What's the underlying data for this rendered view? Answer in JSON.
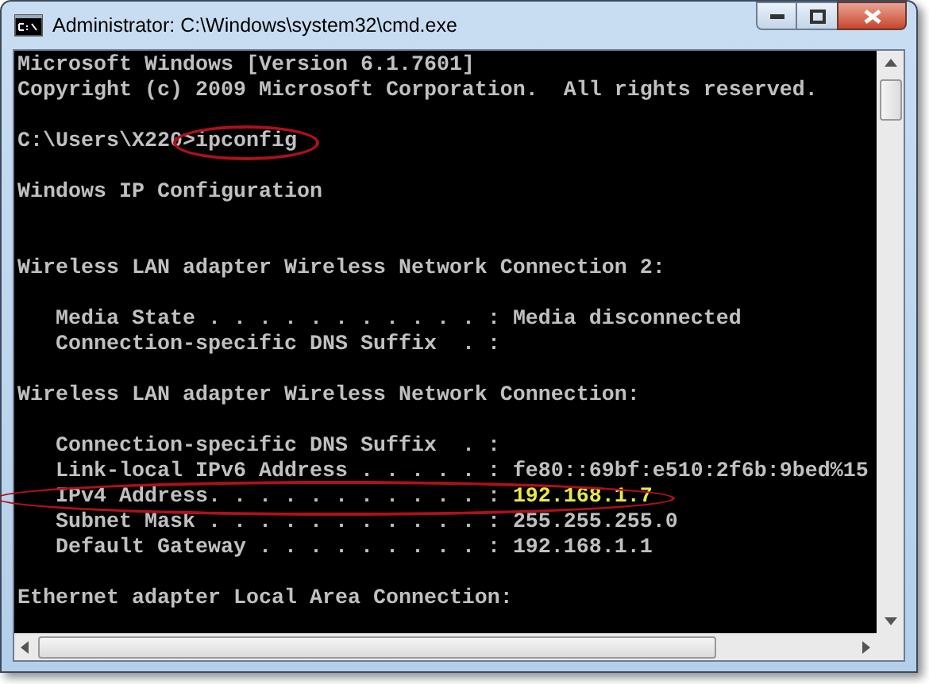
{
  "window": {
    "title": "Administrator: C:\\Windows\\system32\\cmd.exe"
  },
  "lines": [
    {
      "kind": "output",
      "text": "Microsoft Windows [Version 6.1.7601]"
    },
    {
      "kind": "output",
      "text": "Copyright (c) 2009 Microsoft Corporation.  All rights reserved."
    },
    {
      "kind": "blank"
    },
    {
      "kind": "prompt",
      "prompt": "C:\\Users\\X220>",
      "command": "ipconfig",
      "circled": true
    },
    {
      "kind": "blank"
    },
    {
      "kind": "output",
      "text": "Windows IP Configuration"
    },
    {
      "kind": "blank"
    },
    {
      "kind": "blank"
    },
    {
      "kind": "output",
      "text": "Wireless LAN adapter Wireless Network Connection 2:"
    },
    {
      "kind": "blank"
    },
    {
      "kind": "field",
      "label": "Media State . . . . . . . . . . . :",
      "value": "Media disconnected",
      "highlighted": false,
      "circled": false
    },
    {
      "kind": "field",
      "label": "Connection-specific DNS Suffix  . :",
      "circled": false
    },
    {
      "kind": "blank"
    },
    {
      "kind": "output",
      "text": "Wireless LAN adapter Wireless Network Connection:"
    },
    {
      "kind": "blank"
    },
    {
      "kind": "field",
      "label": "Connection-specific DNS Suffix  . :",
      "circled": false
    },
    {
      "kind": "field",
      "label": "Link-local IPv6 Address . . . . . :",
      "value": "fe80::69bf:e510:2f6b:9bed%15",
      "highlighted": false,
      "circled": false
    },
    {
      "kind": "field",
      "label": "IPv4 Address. . . . . . . . . . . :",
      "value": "192.168.1.7",
      "highlighted": true,
      "circled": true
    },
    {
      "kind": "field",
      "label": "Subnet Mask . . . . . . . . . . . :",
      "value": "255.255.255.0",
      "highlighted": false,
      "circled": false
    },
    {
      "kind": "field",
      "label": "Default Gateway . . . . . . . . . :",
      "value": "192.168.1.1",
      "highlighted": false,
      "circled": false
    },
    {
      "kind": "blank"
    },
    {
      "kind": "output",
      "text": "Ethernet adapter Local Area Connection:"
    }
  ]
}
